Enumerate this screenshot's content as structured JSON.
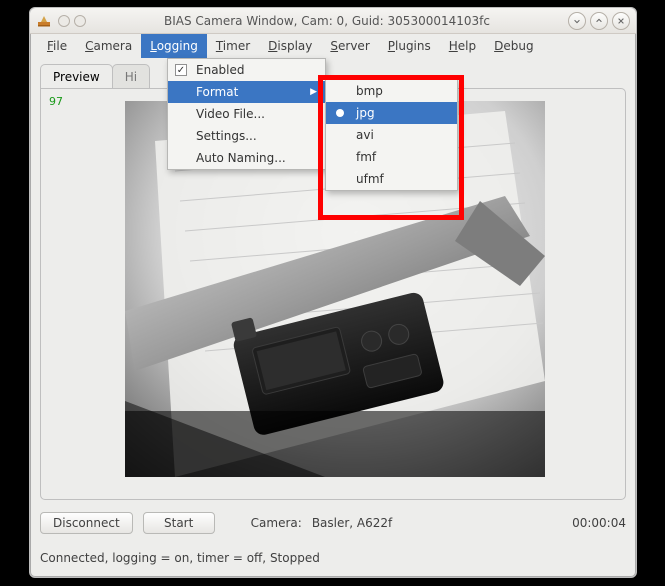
{
  "window": {
    "title": "BIAS Camera Window, Cam: 0, Guid: 305300014103fc"
  },
  "menubar": {
    "items": [
      {
        "label": "File",
        "accel": "F"
      },
      {
        "label": "Camera",
        "accel": "C"
      },
      {
        "label": "Logging",
        "accel": "L"
      },
      {
        "label": "Timer",
        "accel": "T"
      },
      {
        "label": "Display",
        "accel": "D"
      },
      {
        "label": "Server",
        "accel": "S"
      },
      {
        "label": "Plugins",
        "accel": "P"
      },
      {
        "label": "Help",
        "accel": "H"
      },
      {
        "label": "Debug",
        "accel": "D"
      }
    ],
    "active_index": 2
  },
  "logging_menu": {
    "items": [
      {
        "label": "Enabled",
        "type": "checkbox",
        "checked": true
      },
      {
        "label": "Format",
        "type": "submenu",
        "selected": true
      },
      {
        "label": "Video File...",
        "type": "item"
      },
      {
        "label": "Settings...",
        "type": "item"
      },
      {
        "label": "Auto Naming...",
        "type": "item"
      }
    ]
  },
  "format_submenu": {
    "items": [
      {
        "label": "bmp",
        "checked": false
      },
      {
        "label": "jpg",
        "checked": true,
        "selected": true
      },
      {
        "label": "avi",
        "checked": false
      },
      {
        "label": "fmf",
        "checked": false
      },
      {
        "label": "ufmf",
        "checked": false
      }
    ]
  },
  "tabs": {
    "items": [
      {
        "label": "Preview"
      },
      {
        "label": "Hi"
      }
    ],
    "active_index": 0
  },
  "fps_text": "97",
  "bottom": {
    "disconnect": "Disconnect",
    "start": "Start",
    "camera_label": "Camera:",
    "camera_value": "Basler,  A622f",
    "elapsed": "00:00:04"
  },
  "status_text": "Connected, logging = on, timer = off, Stopped"
}
